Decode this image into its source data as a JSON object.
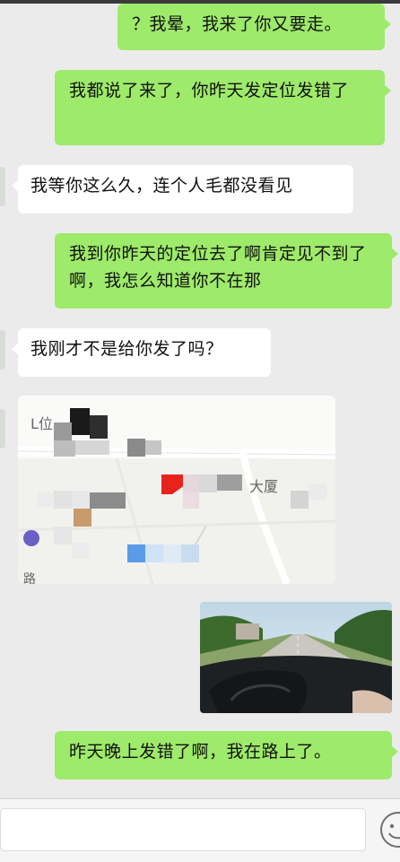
{
  "messages": [
    {
      "side": "right",
      "text": "？我晕，我来了你又要走。"
    },
    {
      "side": "right",
      "text": "我都说了来了，你昨天发定位发错了"
    },
    {
      "side": "left",
      "text": "我等你这么久，连个人毛都没看见"
    },
    {
      "side": "right",
      "text": "我到你昨天的定位去了啊肯定见不到了啊，我怎么知道你不在那"
    },
    {
      "side": "left",
      "text": "我刚才不是给你发了吗？"
    },
    {
      "side": "left",
      "type": "location",
      "map_labels": [
        "L位",
        "大厦",
        "路"
      ]
    },
    {
      "side": "right",
      "type": "image"
    },
    {
      "side": "right",
      "text": "昨天晚上发错了啊，我在路上了。"
    }
  ],
  "input": {
    "placeholder": ""
  },
  "colors": {
    "sent_bubble": "#9eea6a",
    "received_bubble": "#ffffff",
    "background": "#ebebeb"
  },
  "icons": {
    "emoji": "smiley-face-icon"
  }
}
